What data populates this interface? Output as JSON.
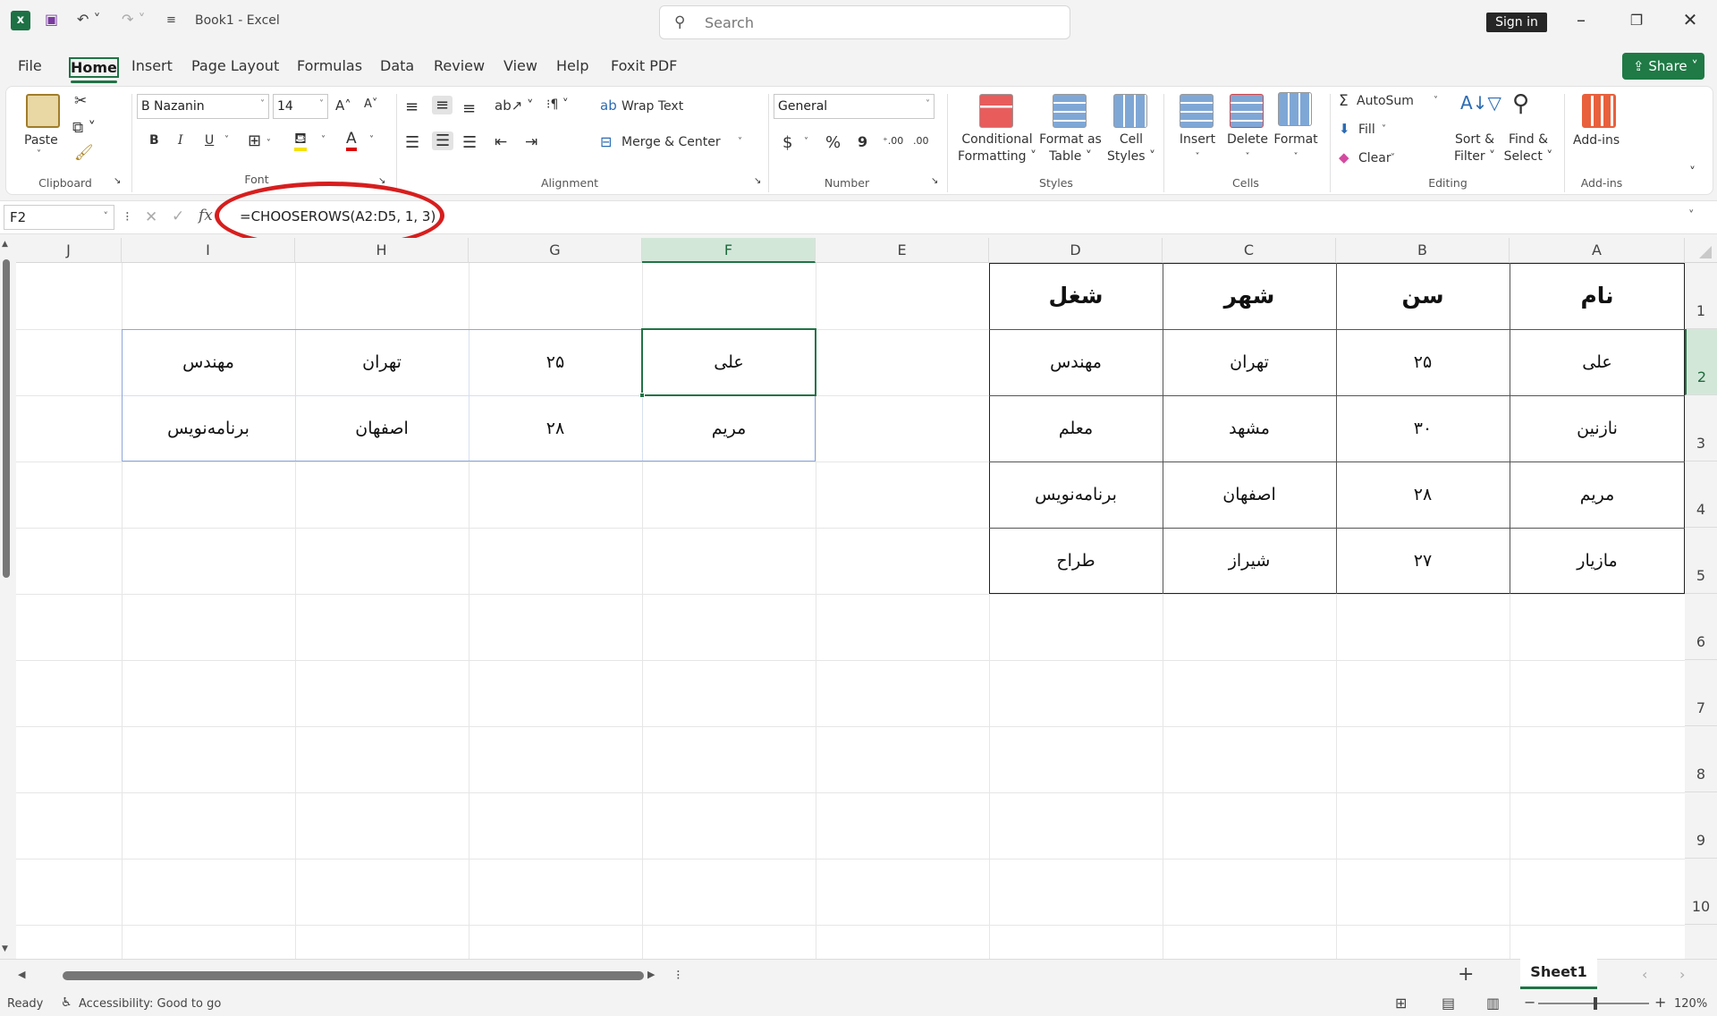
{
  "titlebar": {
    "title": "Book1 - Excel",
    "search_placeholder": "Search",
    "signin": "Sign in"
  },
  "tabs": [
    "File",
    "Home",
    "Insert",
    "Page Layout",
    "Formulas",
    "Data",
    "Review",
    "View",
    "Help",
    "Foxit PDF"
  ],
  "share_label": "Share",
  "ribbon": {
    "clipboard": {
      "paste": "Paste",
      "group": "Clipboard"
    },
    "font": {
      "name": "B Nazanin",
      "size": "14",
      "bold": "B",
      "italic": "I",
      "underline": "U",
      "font_color_glyph": "A",
      "grow": "A˄",
      "shrink": "A˅",
      "group": "Font"
    },
    "alignment": {
      "wrap": "Wrap Text",
      "merge": "Merge & Center",
      "group": "Alignment"
    },
    "number": {
      "format": "General",
      "currency": "$",
      "percent": "%",
      "comma": "9",
      "inc_decimal": "⁺.00",
      "dec_decimal": ".00",
      "group": "Number"
    },
    "styles": {
      "conditional": [
        "Conditional",
        "Formatting ˅"
      ],
      "format_table": [
        "Format as",
        "Table ˅"
      ],
      "cell_styles": [
        "Cell",
        "Styles ˅"
      ],
      "group": "Styles"
    },
    "cells": {
      "insert": "Insert",
      "delete": "Delete",
      "format": "Format",
      "group": "Cells"
    },
    "editing": {
      "autosum": "AutoSum",
      "fill": "Fill",
      "clear": "Clear",
      "sort": [
        "Sort &",
        "Filter ˅"
      ],
      "find": [
        "Find &",
        "Select ˅"
      ],
      "group": "Editing"
    },
    "addins": {
      "label": "Add-ins",
      "group": "Add-ins"
    }
  },
  "formula_bar": {
    "name_box": "F2",
    "fx": "fx",
    "formula": "=CHOOSEROWS(A2:D5, 1, 3)"
  },
  "columns": [
    "J",
    "I",
    "H",
    "G",
    "F",
    "E",
    "D",
    "C",
    "B",
    "A"
  ],
  "rows": [
    "1",
    "2",
    "3",
    "4",
    "5",
    "6",
    "7",
    "8",
    "9",
    "10"
  ],
  "source_table": {
    "headers": [
      "نام",
      "سن",
      "شهر",
      "شغل"
    ],
    "rows": [
      [
        "علی",
        "۲۵",
        "تهران",
        "مهندس"
      ],
      [
        "نازنین",
        "۳۰",
        "مشهد",
        "معلم"
      ],
      [
        "مریم",
        "۲۸",
        "اصفهان",
        "برنامه‌نویس"
      ],
      [
        "مازیار",
        "۲۷",
        "شیراز",
        "طراح"
      ]
    ]
  },
  "result_table": {
    "rows": [
      [
        "علی",
        "۲۵",
        "تهران",
        "مهندس"
      ],
      [
        "مریم",
        "۲۸",
        "اصفهان",
        "برنامه‌نویس"
      ]
    ]
  },
  "sheet_tab": "Sheet1",
  "status": {
    "ready": "Ready",
    "accessibility": "Accessibility: Good to go",
    "zoom": "120%"
  },
  "colors": {
    "accent": "#217346",
    "highlight_circle": "#d71e1e"
  }
}
